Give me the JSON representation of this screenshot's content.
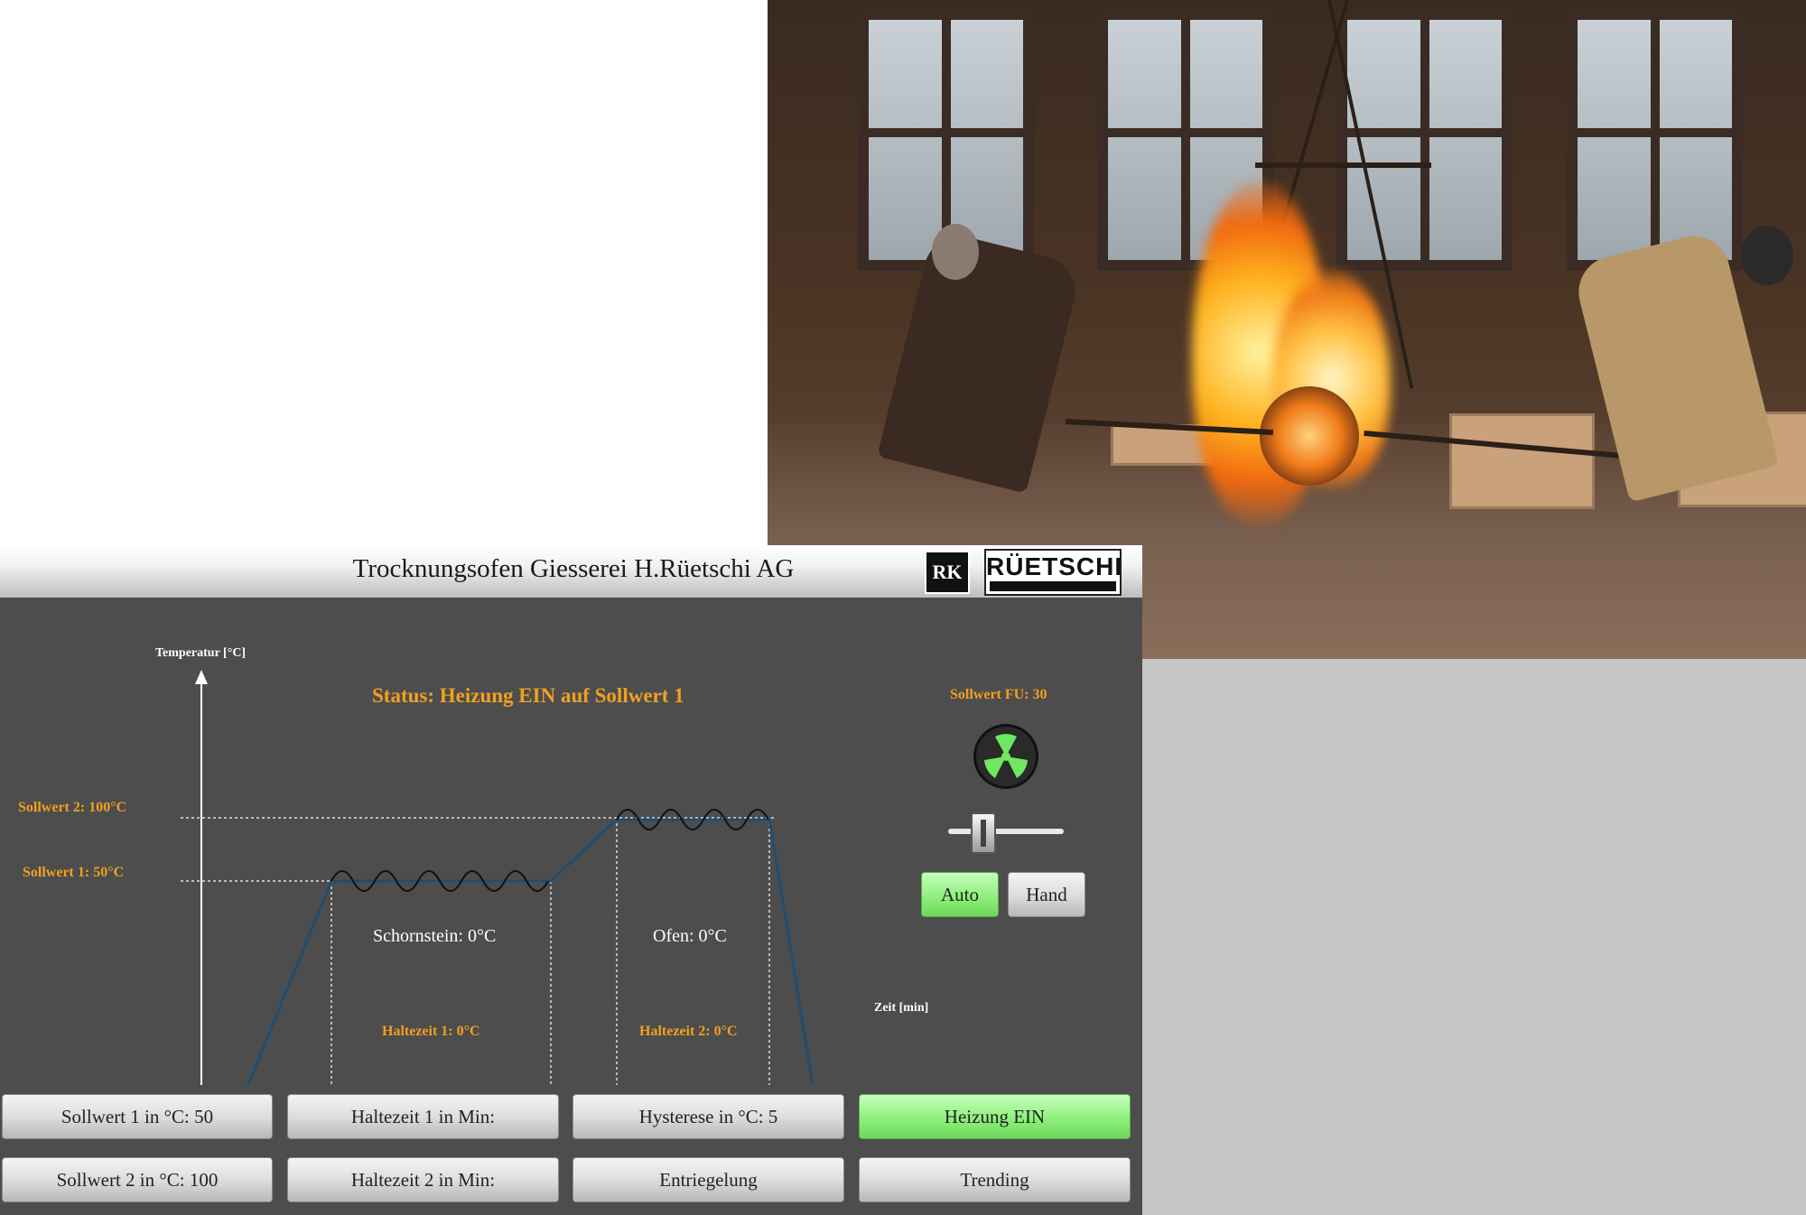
{
  "header": {
    "title": "Trocknungsofen Giesserei H.Rüetschi AG",
    "logo_rk": "RK",
    "logo_brand": "RÜETSCHI"
  },
  "process": {
    "status": "Status: Heizung EIN auf Sollwert 1",
    "sollwert_fu": "Sollwert FU: 30",
    "y_axis_label": "Temperatur [°C]",
    "x_axis_label": "Zeit [min]",
    "sollwert2_label": "Sollwert 2: 100°C",
    "sollwert1_label": "Sollwert 1: 50°C",
    "haltezeit1_label": "Haltezeit 1: 0°C",
    "haltezeit2_label": "Haltezeit 2: 0°C",
    "schornstein": "Schornstein: 0°C",
    "ofen": "Ofen: 0°C",
    "fan_state": "running",
    "fan_color": "#6ee860",
    "active_color": "#8ef07c",
    "label_color": "#f0a020"
  },
  "mode": {
    "auto_label": "Auto",
    "hand_label": "Hand",
    "active": "Auto"
  },
  "buttons": {
    "sollwert1": "Sollwert 1 in °C: 50",
    "haltezeit1": "Haltezeit 1 in Min:",
    "hysterese": "Hysterese in °C: 5",
    "heizung": "Heizung EIN",
    "sollwert2": "Sollwert 2 in °C: 100",
    "haltezeit2": "Haltezeit 2 in Min:",
    "entriegelung": "Entriegelung",
    "trending": "Trending"
  }
}
